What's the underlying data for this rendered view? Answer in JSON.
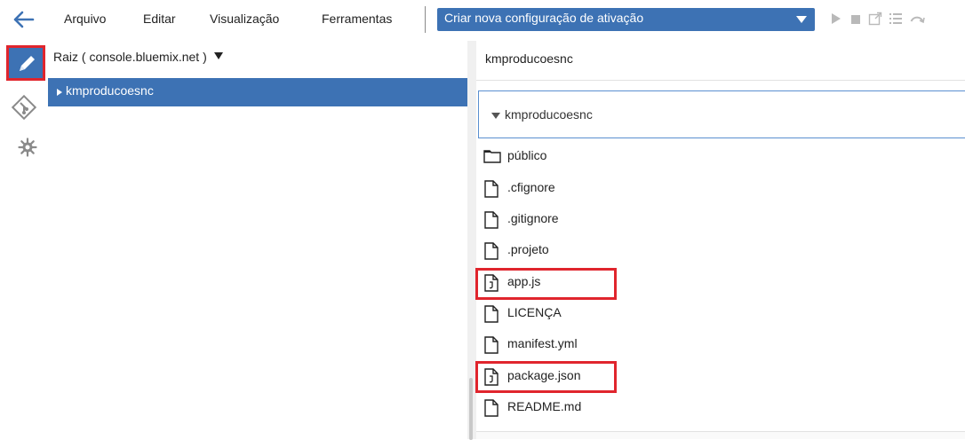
{
  "menubar": {
    "items": [
      "Arquivo",
      "Editar",
      "Visualização",
      "Ferramentas"
    ],
    "launch_config": "Criar nova configuração de ativação",
    "toolbar_icons": [
      "play-icon",
      "stop-icon",
      "open-external-icon",
      "list-icon",
      "refresh-icon"
    ]
  },
  "rail": {
    "items": [
      "edit-icon",
      "git-icon",
      "settings-icon"
    ]
  },
  "navigator": {
    "root": "Raiz ( console.bluemix.net )",
    "selected_folder": "kmproducoesnc"
  },
  "editor": {
    "breadcrumb": "kmproducoesnc",
    "folder_header": "kmproducoesnc",
    "files": [
      {
        "name": "público",
        "type": "folder"
      },
      {
        "name": ".cfignore",
        "type": "file"
      },
      {
        "name": ".gitignore",
        "type": "file"
      },
      {
        "name": ".projeto",
        "type": "file"
      },
      {
        "name": "app.js",
        "type": "code-file"
      },
      {
        "name": "LICENÇA",
        "type": "file"
      },
      {
        "name": "manifest.yml",
        "type": "file"
      },
      {
        "name": "package.json",
        "type": "code-file"
      },
      {
        "name": "README.md",
        "type": "file"
      }
    ]
  },
  "colors": {
    "accent": "#3d72b4",
    "highlight": "#e0252d"
  }
}
